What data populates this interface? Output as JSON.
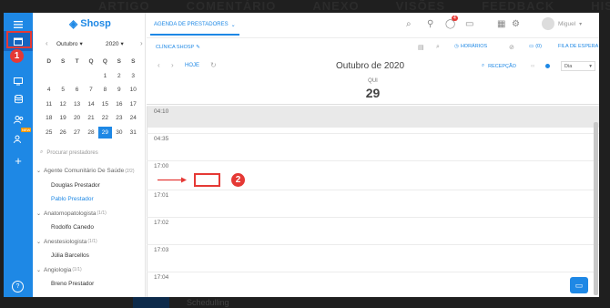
{
  "background_tabs": [
    "ARTIGO",
    "COMENTÁRIO",
    "ANEXO",
    "VISÕES",
    "FEEDBACK",
    "HISTÓRICO"
  ],
  "background_bottom": "Schedulling",
  "markers": {
    "one": "1",
    "two": "2"
  },
  "rail": {
    "items": [
      "menu-icon",
      "calendar-icon",
      "monitor-icon",
      "database-icon",
      "group-icon",
      "user-new-icon",
      "plus-icon",
      "help-icon"
    ],
    "new_badge": "NEW"
  },
  "logo": {
    "text": "Shosp"
  },
  "calendar": {
    "month": "Outubro",
    "year": "2020",
    "weekdays": [
      "D",
      "S",
      "T",
      "Q",
      "Q",
      "S",
      "S"
    ],
    "weeks": [
      [
        "",
        "",
        "",
        "",
        "1",
        "2",
        "3"
      ],
      [
        "4",
        "5",
        "6",
        "7",
        "8",
        "9",
        "10"
      ],
      [
        "11",
        "12",
        "13",
        "14",
        "15",
        "16",
        "17"
      ],
      [
        "18",
        "19",
        "20",
        "21",
        "22",
        "23",
        "24"
      ],
      [
        "25",
        "26",
        "27",
        "28",
        "29",
        "30",
        "31"
      ]
    ],
    "selected_day": "29"
  },
  "search": {
    "placeholder": "Procurar prestadores"
  },
  "providers": [
    {
      "type": "group",
      "label": "Agente Comunitário De Saúde",
      "count": "(2/2)"
    },
    {
      "type": "prov",
      "label": "Douglas Prestador"
    },
    {
      "type": "prov",
      "label": "Pablo Prestador",
      "active": true
    },
    {
      "type": "group",
      "label": "Anatomopatologista",
      "count": "(1/1)"
    },
    {
      "type": "prov",
      "label": "Rodolfo Canedo"
    },
    {
      "type": "group",
      "label": "Anestesiologista",
      "count": "(1/1)"
    },
    {
      "type": "prov",
      "label": "Júlia Barcellos"
    },
    {
      "type": "group",
      "label": "Angiologia",
      "count": "(1/1)"
    },
    {
      "type": "prov",
      "label": "Breno Prestador"
    }
  ],
  "topbar": {
    "tab_label": "AGENDA DE PRESTADORES",
    "notif_count": "4",
    "user_name": "Miguel"
  },
  "subbar": {
    "clinic": "CLÍNICA SHOSP",
    "horarios": "HORÁRIOS",
    "count": "(0)",
    "fila": "FILA DE ESPERA"
  },
  "navbar": {
    "hoje": "HOJE",
    "title": "Outubro de 2020",
    "recepcao": "RECEPÇÃO",
    "view": "Dia"
  },
  "day": {
    "dow": "QUI",
    "num": "29"
  },
  "slots": [
    "04:10",
    "04:35",
    "17:00",
    "17:01",
    "17:02",
    "17:03",
    "17:04"
  ],
  "colors": {
    "accent": "#1e88e5",
    "annotation": "#e53935"
  }
}
